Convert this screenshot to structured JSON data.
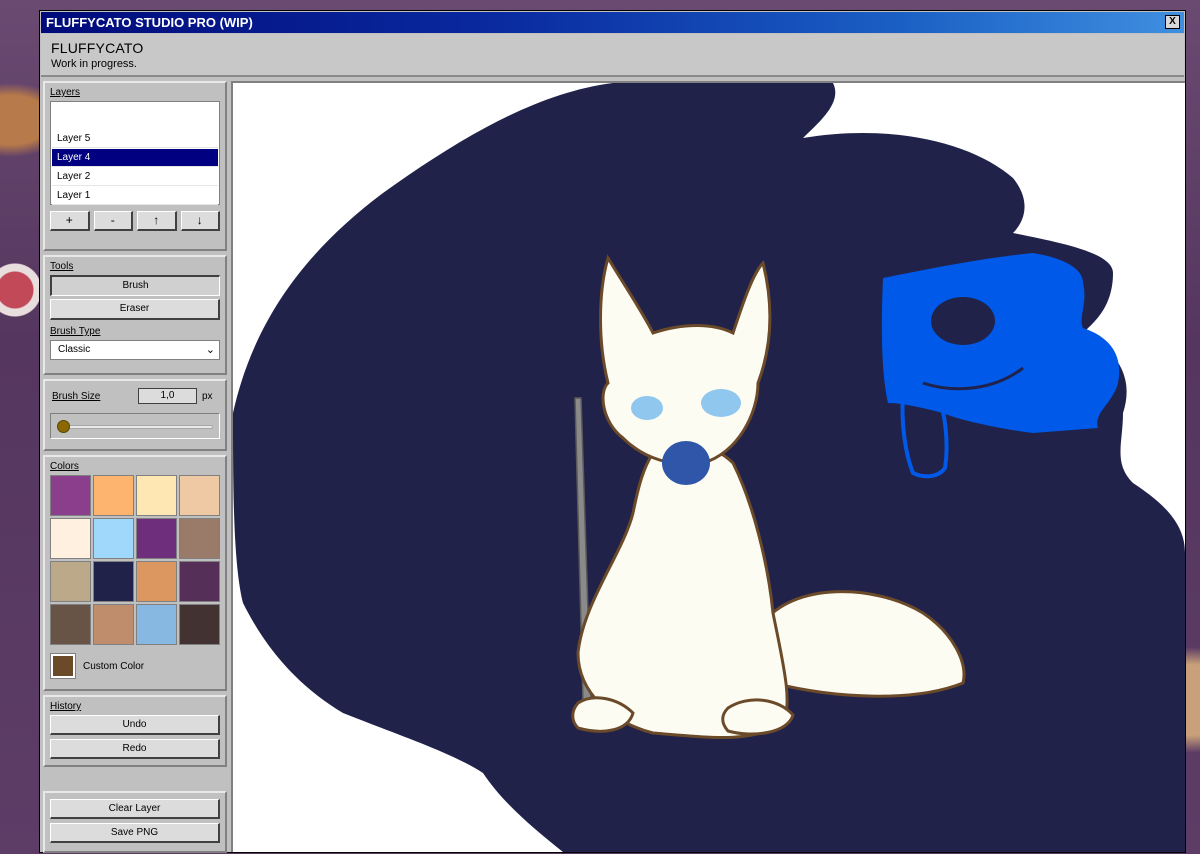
{
  "window": {
    "title": "FLUFFYCATO STUDIO PRO (WIP)",
    "close_label": "X"
  },
  "header": {
    "app_name": "FLUFFYCATO",
    "subtitle": "Work in progress."
  },
  "layers": {
    "title": "Layers",
    "items": [
      {
        "label": "Layer 5",
        "selected": false
      },
      {
        "label": "Layer 4",
        "selected": true
      },
      {
        "label": "Layer 2",
        "selected": false
      },
      {
        "label": "Layer 1",
        "selected": false
      }
    ],
    "buttons": {
      "add": "+",
      "remove": "-",
      "up": "↑",
      "down": "↓"
    }
  },
  "tools": {
    "title": "Tools",
    "brush": "Brush",
    "eraser": "Eraser",
    "active": "Brush",
    "brush_type_label": "Brush Type",
    "brush_type_value": "Classic"
  },
  "brush_size": {
    "label": "Brush Size",
    "value": "1,0",
    "unit": "px",
    "slider_fraction": 0.0
  },
  "colors": {
    "title": "Colors",
    "palette": [
      "#8b3e8c",
      "#fdb46f",
      "#ffe7b4",
      "#efc9a4",
      "#fff0e0",
      "#9fd8fb",
      "#6e2e7c",
      "#9a7a68",
      "#bca98a",
      "#20224a",
      "#dc9660",
      "#552f58",
      "#685446",
      "#bf8c6c",
      "#86b8e2",
      "#423332"
    ],
    "custom_label": "Custom Color",
    "custom_color": "#6b4a2a"
  },
  "history": {
    "title": "History",
    "undo": "Undo",
    "redo": "Redo"
  },
  "actions": {
    "clear_layer": "Clear Layer",
    "save_png": "Save PNG"
  },
  "canvas": {
    "background": "#ffffff",
    "dark_blob_color": "#20224a",
    "character_fill": "#fdfcf2",
    "outline_color": "#6b4a2a",
    "blue_shape_color": "#0059e8"
  }
}
